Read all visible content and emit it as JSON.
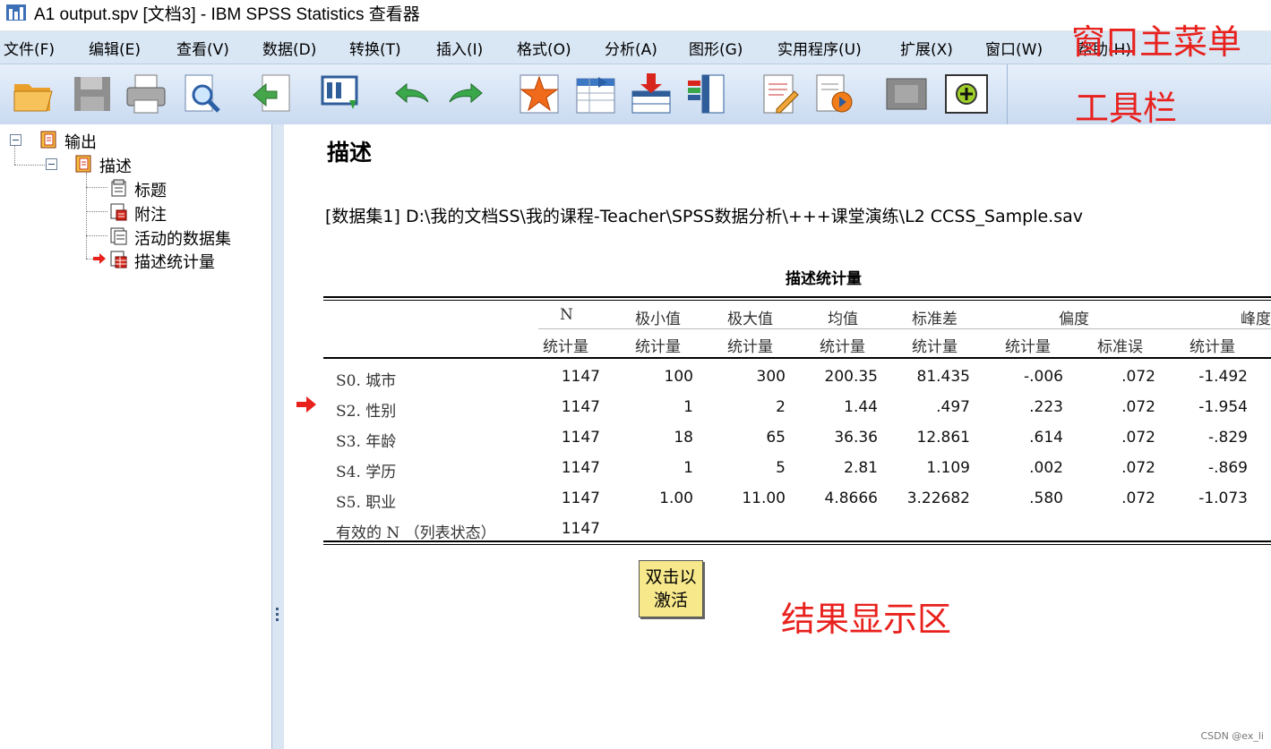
{
  "window": {
    "title": "A1 output.spv [文档3] - IBM SPSS Statistics 查看器"
  },
  "menu": [
    "文件(F)",
    "编辑(E)",
    "查看(V)",
    "数据(D)",
    "转换(T)",
    "插入(I)",
    "格式(O)",
    "分析(A)",
    "图形(G)",
    "实用程序(U)",
    "扩展(X)",
    "窗口(W)",
    "帮助(H)"
  ],
  "toolbar": [
    "open-icon",
    "save-icon",
    "print-icon",
    "print-preview-icon",
    "export-icon",
    "recall-dialog-icon",
    "undo-icon",
    "redo-icon",
    "goto-case-icon",
    "goto-variable-icon",
    "insert-cases-icon",
    "insert-variables-icon",
    "designate-window-icon",
    "run-script-icon",
    "viewer-off-icon",
    "add-icon"
  ],
  "annotations": {
    "menu": "窗口主菜单",
    "toolbar": "工具栏",
    "results": "结果显示区"
  },
  "outline": {
    "root": "输出",
    "group": "描述",
    "items": [
      "标题",
      "附注",
      "活动的数据集",
      "描述统计量"
    ]
  },
  "results": {
    "heading": "描述",
    "dataset_line": "[数据集1] D:\\我的文档SS\\我的课程-Teacher\\SPSS数据分析\\+++课堂演练\\L2 CCSS_Sample.sav",
    "table": {
      "title": "描述统计量",
      "columns": [
        "N",
        "极小值",
        "极大值",
        "均值",
        "标准差",
        "偏度",
        "峰度"
      ],
      "subcolumns": [
        "统计量",
        "统计量",
        "统计量",
        "统计量",
        "统计量",
        "统计量",
        "标准误",
        "统计量"
      ],
      "rows": [
        {
          "label": "S0. 城市",
          "values": [
            "1147",
            "100",
            "300",
            "200.35",
            "81.435",
            "-.006",
            ".072",
            "-1.492"
          ]
        },
        {
          "label": "S2. 性别",
          "values": [
            "1147",
            "1",
            "2",
            "1.44",
            ".497",
            ".223",
            ".072",
            "-1.954"
          ]
        },
        {
          "label": "S3. 年龄",
          "values": [
            "1147",
            "18",
            "65",
            "36.36",
            "12.861",
            ".614",
            ".072",
            "-.829"
          ]
        },
        {
          "label": "S4. 学历",
          "values": [
            "1147",
            "1",
            "5",
            "2.81",
            "1.109",
            ".002",
            ".072",
            "-.869"
          ]
        },
        {
          "label": "S5. 职业",
          "values": [
            "1147",
            "1.00",
            "11.00",
            "4.8666",
            "3.22682",
            ".580",
            ".072",
            "-1.073"
          ]
        },
        {
          "label": "有效的 N （列表状态）",
          "values": [
            "1147",
            "",
            "",
            "",
            "",
            "",
            "",
            ""
          ]
        }
      ]
    },
    "activate_note": [
      "双击以",
      "激活"
    ]
  },
  "watermark": "CSDN @ex_li"
}
